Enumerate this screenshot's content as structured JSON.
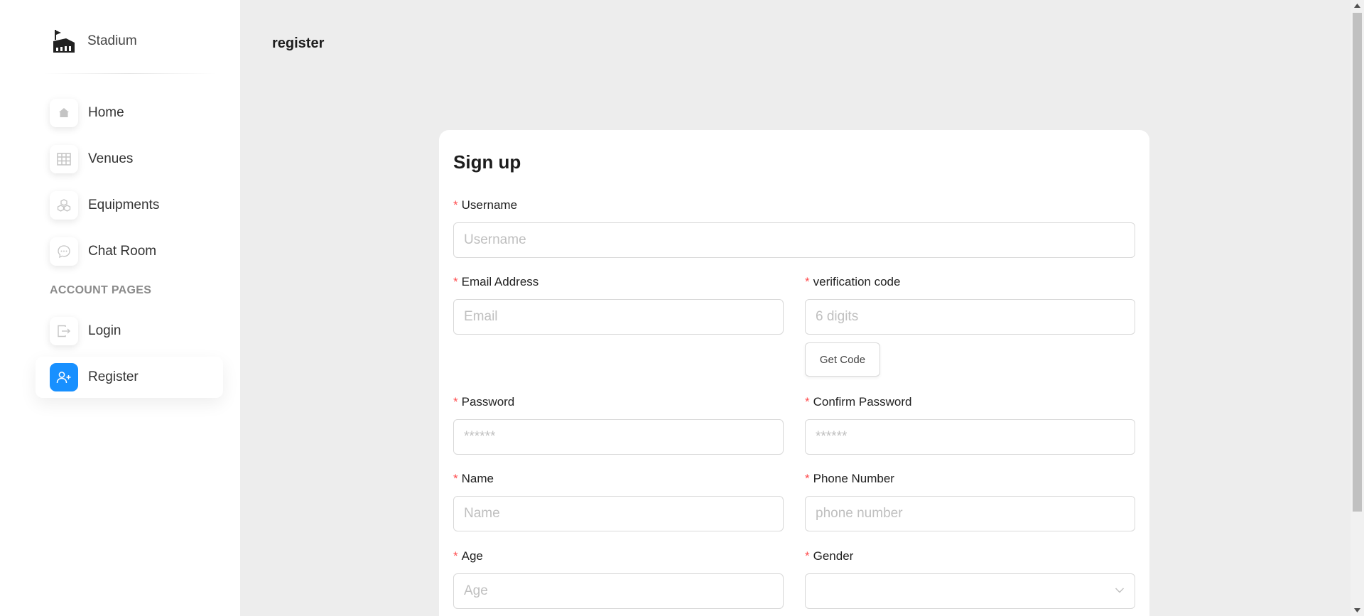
{
  "brand": {
    "name": "Stadium",
    "logo_icon": "stadium-icon"
  },
  "sidebar": {
    "items": [
      {
        "label": "Home",
        "icon": "home-icon"
      },
      {
        "label": "Venues",
        "icon": "table-icon"
      },
      {
        "label": "Equipments",
        "icon": "cubes-icon"
      },
      {
        "label": "Chat Room",
        "icon": "chat-icon"
      }
    ],
    "section_title": "ACCOUNT PAGES",
    "account_items": [
      {
        "label": "Login",
        "icon": "login-icon"
      },
      {
        "label": "Register",
        "icon": "add-user-icon",
        "active": true
      }
    ]
  },
  "header": {
    "title": "register"
  },
  "form": {
    "title": "Sign up",
    "username": {
      "label": "Username",
      "placeholder": "Username"
    },
    "email": {
      "label": "Email Address",
      "placeholder": "Email"
    },
    "code": {
      "label": "verification code",
      "placeholder": "6 digits",
      "button": "Get Code"
    },
    "password": {
      "label": "Password",
      "placeholder": "******"
    },
    "confirm_password": {
      "label": "Confirm Password",
      "placeholder": "******"
    },
    "name": {
      "label": "Name",
      "placeholder": "Name"
    },
    "phone": {
      "label": "Phone Number",
      "placeholder": "phone number"
    },
    "age": {
      "label": "Age",
      "placeholder": "Age"
    },
    "gender": {
      "label": "Gender",
      "value": ""
    },
    "required_mark": "*"
  },
  "colors": {
    "accent": "#1890ff",
    "required": "#ff4d4f",
    "background": "#ededed",
    "sidebar": "#ffffff"
  }
}
